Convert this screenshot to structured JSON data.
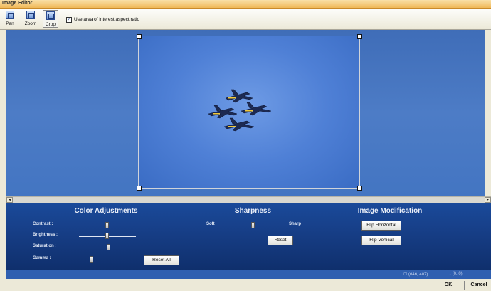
{
  "window": {
    "title": "Image Editor"
  },
  "toolbar": {
    "tools": [
      {
        "label": "Pan",
        "icon": "pan-icon"
      },
      {
        "label": "Zoom",
        "icon": "zoom-icon"
      },
      {
        "label": "Crop",
        "icon": "crop-icon"
      }
    ],
    "aspect_checkbox": {
      "checked": true,
      "mark": "✓",
      "label": "Use area of interest aspect ratio"
    }
  },
  "scrollbar": {
    "left_arrow": "◄",
    "right_arrow": "►"
  },
  "panel": {
    "color": {
      "title": "Color Adjustments",
      "sliders": [
        {
          "label": "Contrast :",
          "value": 0.5
        },
        {
          "label": "Brightness :",
          "value": 0.5
        },
        {
          "label": "Saturation :",
          "value": 0.52
        },
        {
          "label": "Gamma :",
          "value": 0.22
        }
      ],
      "reset_all": "Reset All"
    },
    "sharpness": {
      "title": "Sharpness",
      "min_label": "Soft",
      "max_label": "Sharp",
      "value": 0.5,
      "reset": "Reset"
    },
    "modification": {
      "title": "Image Modification",
      "flip_horizontal": "Flip Horizontal",
      "flip_vertical": "Flip Vertical"
    }
  },
  "status": {
    "size": "☐ (646, 407)",
    "offset": "↕ (0, 0)"
  },
  "dialog": {
    "ok": "OK",
    "cancel": "Cancel"
  },
  "colors": {
    "canvas": "#4d7cc6",
    "panel": "#173f88",
    "status": "#2f5fb0"
  }
}
